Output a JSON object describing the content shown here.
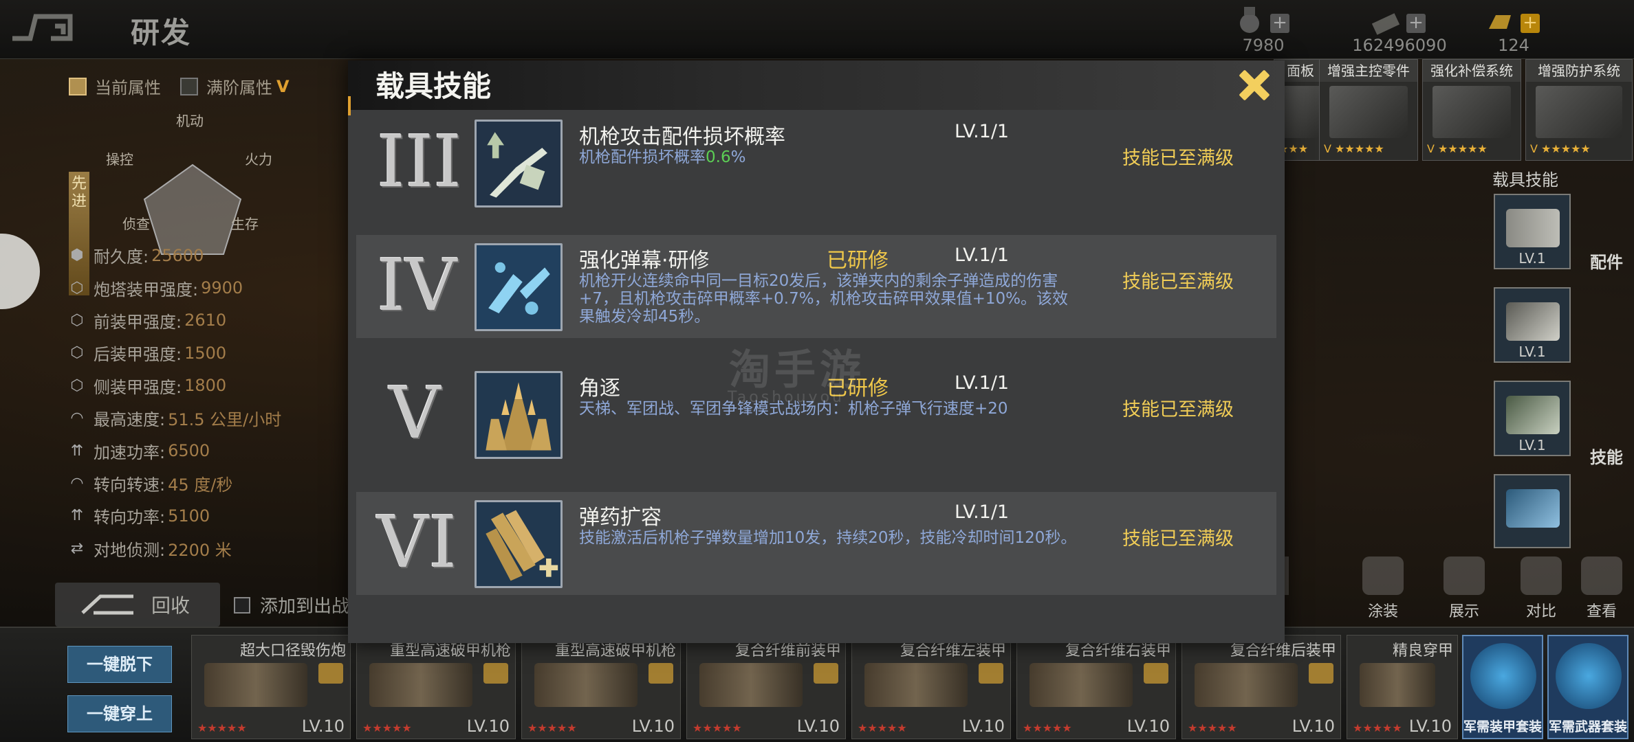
{
  "header": {
    "title": "研发",
    "resources": [
      {
        "icon": "medal-icon",
        "amount": "7980"
      },
      {
        "icon": "cash-stack-icon",
        "amount": "162496090"
      },
      {
        "icon": "gold-bar-icon",
        "amount": "124"
      }
    ]
  },
  "left_panel": {
    "checkbox_current": "当前属性",
    "checkbox_max": "满阶属性",
    "max_badge": "V",
    "side_label": "先进",
    "radar": {
      "top": "机动",
      "left": "操控",
      "right": "火力",
      "bottom_left": "侦查",
      "bottom_right": "生存"
    },
    "stats": [
      {
        "label": "耐久度:",
        "value": "25600"
      },
      {
        "label": "炮塔装甲强度:",
        "value": "9900"
      },
      {
        "label": "前装甲强度:",
        "value": "2610"
      },
      {
        "label": "后装甲强度:",
        "value": "1500"
      },
      {
        "label": "侧装甲强度:",
        "value": "1800"
      },
      {
        "label": "最高速度:",
        "value": "51.5 公里/小时"
      },
      {
        "label": "加速功率:",
        "value": "6500"
      },
      {
        "label": "转向转速:",
        "value": "45 度/秒"
      },
      {
        "label": "转向功率:",
        "value": "5100"
      },
      {
        "label": "对地侦测:",
        "value": "2200 米"
      }
    ],
    "recycle_label": "回收",
    "add_to_battle_label": "添加到出战"
  },
  "right_panel": {
    "parts": [
      {
        "name": "面板",
        "lv": "V"
      },
      {
        "name": "增强主控零件",
        "lv": "V"
      },
      {
        "name": "强化补偿系统",
        "lv": "V"
      },
      {
        "name": "增强防护系统",
        "lv": "V"
      }
    ],
    "tab_parts": "配件",
    "tab_skills": "技能",
    "skills_title": "载具技能",
    "mini_skill_levels": [
      "LV.1",
      "LV.1",
      "LV.1"
    ],
    "actions": [
      {
        "icon": "paint-icon",
        "label": "涂装"
      },
      {
        "icon": "showcase-icon",
        "label": "展示"
      },
      {
        "icon": "compare-icon",
        "label": "对比"
      },
      {
        "icon": "camera-icon",
        "label": "查看"
      }
    ]
  },
  "bottom_bar": {
    "unequip_all": "一键脱下",
    "equip_all": "一键穿上",
    "equipment": [
      {
        "name": "超大口径毁伤炮",
        "lv": "LV.10",
        "stars": "★★★★★"
      },
      {
        "name": "重型高速破甲机枪",
        "lv": "LV.10",
        "stars": "★★★★★"
      },
      {
        "name": "重型高速破甲机枪",
        "lv": "LV.10",
        "stars": "★★★★★"
      },
      {
        "name": "复合纤维前装甲",
        "lv": "LV.10",
        "stars": "★★★★★"
      },
      {
        "name": "复合纤维左装甲",
        "lv": "LV.10",
        "stars": "★★★★★"
      },
      {
        "name": "复合纤维右装甲",
        "lv": "LV.10",
        "stars": "★★★★★"
      },
      {
        "name": "复合纤维后装甲",
        "lv": "LV.10",
        "stars": "★★★★★"
      },
      {
        "name": "精良穿甲",
        "lv": "LV.10",
        "stars": "★★★★★"
      }
    ],
    "suits": [
      {
        "name": "军需装甲套装"
      },
      {
        "name": "军需武器套装"
      }
    ]
  },
  "modal": {
    "title": "载具技能",
    "close_label": "close",
    "skills": [
      {
        "roman": "III",
        "icon": "machine-gun-upgrade-icon",
        "name": "机枪攻击配件损坏概率",
        "researched": "",
        "level": "LV.1/1",
        "desc_prefix": "机枪配件损坏概率",
        "desc_highlight": "0.6",
        "desc_suffix": "%",
        "status": "技能已至满级"
      },
      {
        "roman": "IV",
        "icon": "broken-gun-icon",
        "name": "强化弹幕·研修",
        "researched": "已研修",
        "level": "LV.1/1",
        "desc": "机枪开火连续命中同一目标20发后，该弹夹内的剩余子弹造成的伤害+7，且机枪攻击碎甲概率+0.7%，机枪攻击碎甲效果值+10%。该效果触发冷却45秒。",
        "status": "技能已至满级"
      },
      {
        "roman": "V",
        "icon": "bullet-speed-icon",
        "name": "角逐",
        "researched": "已研修",
        "level": "LV.1/1",
        "desc": "天梯、军团战、军团争锋模式战场内：机枪子弹飞行速度+20",
        "status": "技能已至满级"
      },
      {
        "roman": "VI",
        "icon": "ammo-expand-icon",
        "name": "弹药扩容",
        "researched": "",
        "level": "LV.1/1",
        "desc": "技能激活后机枪子弹数量增加10发，持续20秒，技能冷却时间120秒。",
        "status": "技能已至满级"
      }
    ]
  },
  "watermark": {
    "cn": "淘手游",
    "en": "Taoshouyou"
  }
}
